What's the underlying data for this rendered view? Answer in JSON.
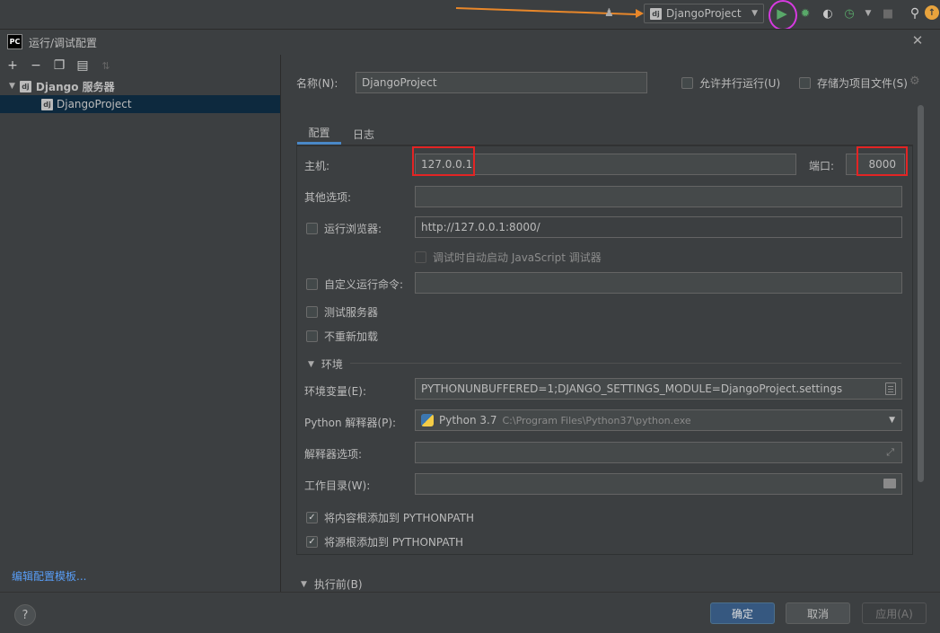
{
  "toolbar": {
    "run_config_name": "DjangoProject",
    "dj_badge": "dj",
    "icons": [
      "user-icon",
      "run-icon",
      "debug-icon",
      "coverage-icon",
      "profile-icon",
      "stop-icon",
      "search-icon",
      "update-icon"
    ],
    "annotation_arrow_color": "#e8872a",
    "annotation_circle_color": "#d63ae0"
  },
  "dialog": {
    "logo": "PC",
    "title": "运行/调试配置"
  },
  "left": {
    "tree_root": "Django 服务器",
    "tree_child": "DjangoProject",
    "edit_template_link": "编辑配置模板..."
  },
  "form": {
    "name_label": "名称(N):",
    "name_value": "DjangoProject",
    "allow_parallel": "允许并行运行(U)",
    "store_as_file": "存储为项目文件(S)",
    "tabs": [
      "配置",
      "日志"
    ],
    "host_label": "主机:",
    "host_value": "127.0.0.1",
    "port_label": "端口:",
    "port_value": "8000",
    "other_options_label": "其他选项:",
    "run_browser_label": "运行浏览器:",
    "browser_url": "http://127.0.0.1:8000/",
    "js_debugger_label": "调试时自动启动 JavaScript 调试器",
    "custom_cmd_label": "自定义运行命令:",
    "test_server_label": "测试服务器",
    "no_reload_label": "不重新加载",
    "env_section": "环境",
    "env_vars_label": "环境变量(E):",
    "env_vars_value": "PYTHONUNBUFFERED=1;DJANGO_SETTINGS_MODULE=DjangoProject.settings",
    "interpreter_label": "Python 解释器(P):",
    "interpreter_name": "Python 3.7",
    "interpreter_path": "C:\\Program Files\\Python37\\python.exe",
    "interpreter_options_label": "解释器选项:",
    "workdir_label": "工作目录(W):",
    "add_content_roots": "将内容根添加到 PYTHONPATH",
    "add_source_roots": "将源根添加到 PYTHONPATH",
    "before_launch": "执行前(B)"
  },
  "buttons": {
    "ok": "确定",
    "cancel": "取消",
    "apply": "应用(A)",
    "help": "?"
  },
  "colors": {
    "highlight_red": "#e32424",
    "primary_button": "#365880",
    "link": "#589df6",
    "selection": "#0d293e"
  }
}
